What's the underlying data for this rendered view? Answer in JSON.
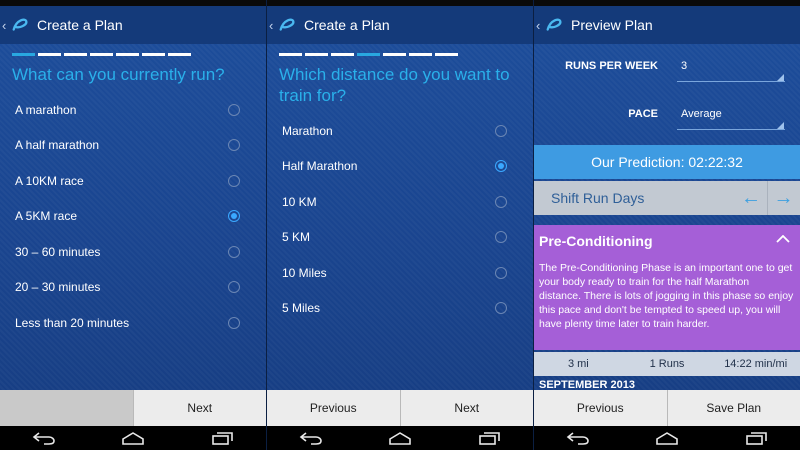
{
  "colors": {
    "action_bar": "#143a7a",
    "accent": "#2ab0ea",
    "panel_bg": "#1a4590",
    "prediction": "#3e9be2",
    "phase": "#a55fd7",
    "button_bar": "#ececec"
  },
  "screens": [
    {
      "title": "Create a Plan",
      "progress": {
        "steps": 7,
        "active": 0
      },
      "question": "What can you currently run?",
      "options": [
        {
          "label": "A marathon",
          "selected": false
        },
        {
          "label": "A half marathon",
          "selected": false
        },
        {
          "label": "A 10KM race",
          "selected": false
        },
        {
          "label": "A 5KM race",
          "selected": true
        },
        {
          "label": "30 – 60 minutes",
          "selected": false
        },
        {
          "label": "20 – 30 minutes",
          "selected": false
        },
        {
          "label": "Less than 20 minutes",
          "selected": false
        }
      ],
      "buttons": {
        "left": "",
        "right": "Next"
      }
    },
    {
      "title": "Create a Plan",
      "progress": {
        "steps": 7,
        "active": 3
      },
      "question": "Which distance do you want to train for?",
      "options": [
        {
          "label": "Marathon",
          "selected": false
        },
        {
          "label": "Half Marathon",
          "selected": true
        },
        {
          "label": "10 KM",
          "selected": false
        },
        {
          "label": "5 KM",
          "selected": false
        },
        {
          "label": "10 Miles",
          "selected": false
        },
        {
          "label": "5 Miles",
          "selected": false
        }
      ],
      "buttons": {
        "left": "Previous",
        "right": "Next"
      }
    },
    {
      "title": "Preview Plan",
      "fields": [
        {
          "label": "RUNS PER WEEK",
          "value": "3"
        },
        {
          "label": "PACE",
          "value": "Average"
        }
      ],
      "prediction": "Our Prediction: 02:22:32",
      "shift_label": "Shift Run Days",
      "phase": {
        "title": "Pre-Conditioning",
        "body": "The Pre-Conditioning Phase is an important one to get your body ready to train for the half Marathon distance. There is lots of jogging in this phase so enjoy this pace and don't be tempted to speed up, you will have plenty time later to train harder."
      },
      "stats": {
        "distance": "3 mi",
        "runs": "1 Runs",
        "pace": "14:22 min/mi"
      },
      "month": "SEPTEMBER 2013",
      "buttons": {
        "left": "Previous",
        "right": "Save Plan"
      }
    }
  ]
}
